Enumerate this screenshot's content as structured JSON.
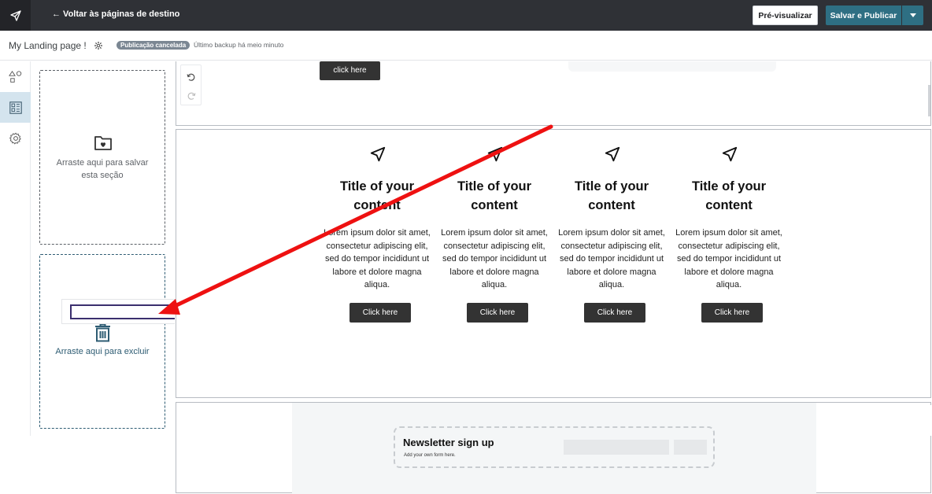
{
  "topbar": {
    "back_label": "← Voltar às páginas de destino",
    "preview_label": "Pré-visualizar",
    "publish_label": "Salvar e Publicar"
  },
  "subbar": {
    "page_name": "My Landing page !",
    "status_badge": "Publicação cancelada",
    "backup_text": "Último backup há meio minuto"
  },
  "sidebar": {
    "items": [
      {
        "icon": "shapes-icon"
      },
      {
        "icon": "layout-sections-icon",
        "active": true
      },
      {
        "icon": "settings-gear-icon"
      }
    ]
  },
  "dropzones": {
    "save_label": "Arraste aqui para salvar esta seção",
    "delete_label": "Arraste aqui para excluir"
  },
  "canvas": {
    "top_section": {
      "button_label": "click here"
    },
    "features": [
      {
        "title": "Title of your content",
        "text": "Lorem ipsum dolor sit amet, consectetur adipiscing elit, sed do tempor incididunt ut labore et dolore magna aliqua.",
        "button": "Click here"
      },
      {
        "title": "Title of your content",
        "text": "Lorem ipsum dolor sit amet, consectetur adipiscing elit, sed do tempor incididunt ut labore et dolore magna aliqua.",
        "button": "Click here"
      },
      {
        "title": "Title of your content",
        "text": "Lorem ipsum dolor sit amet, consectetur adipiscing elit, sed do tempor incididunt ut labore et dolore magna aliqua.",
        "button": "Click here"
      },
      {
        "title": "Title of your content",
        "text": "Lorem ipsum dolor sit amet, consectetur adipiscing elit, sed do tempor incididunt ut labore et dolore magna aliqua.",
        "button": "Click here"
      }
    ],
    "newsletter": {
      "title": "Newsletter sign up",
      "subtitle": "Add your own form here."
    }
  },
  "colors": {
    "topbar": "#2f3136",
    "accent": "#2e6f83",
    "annotation_arrow": "#ee1111"
  }
}
